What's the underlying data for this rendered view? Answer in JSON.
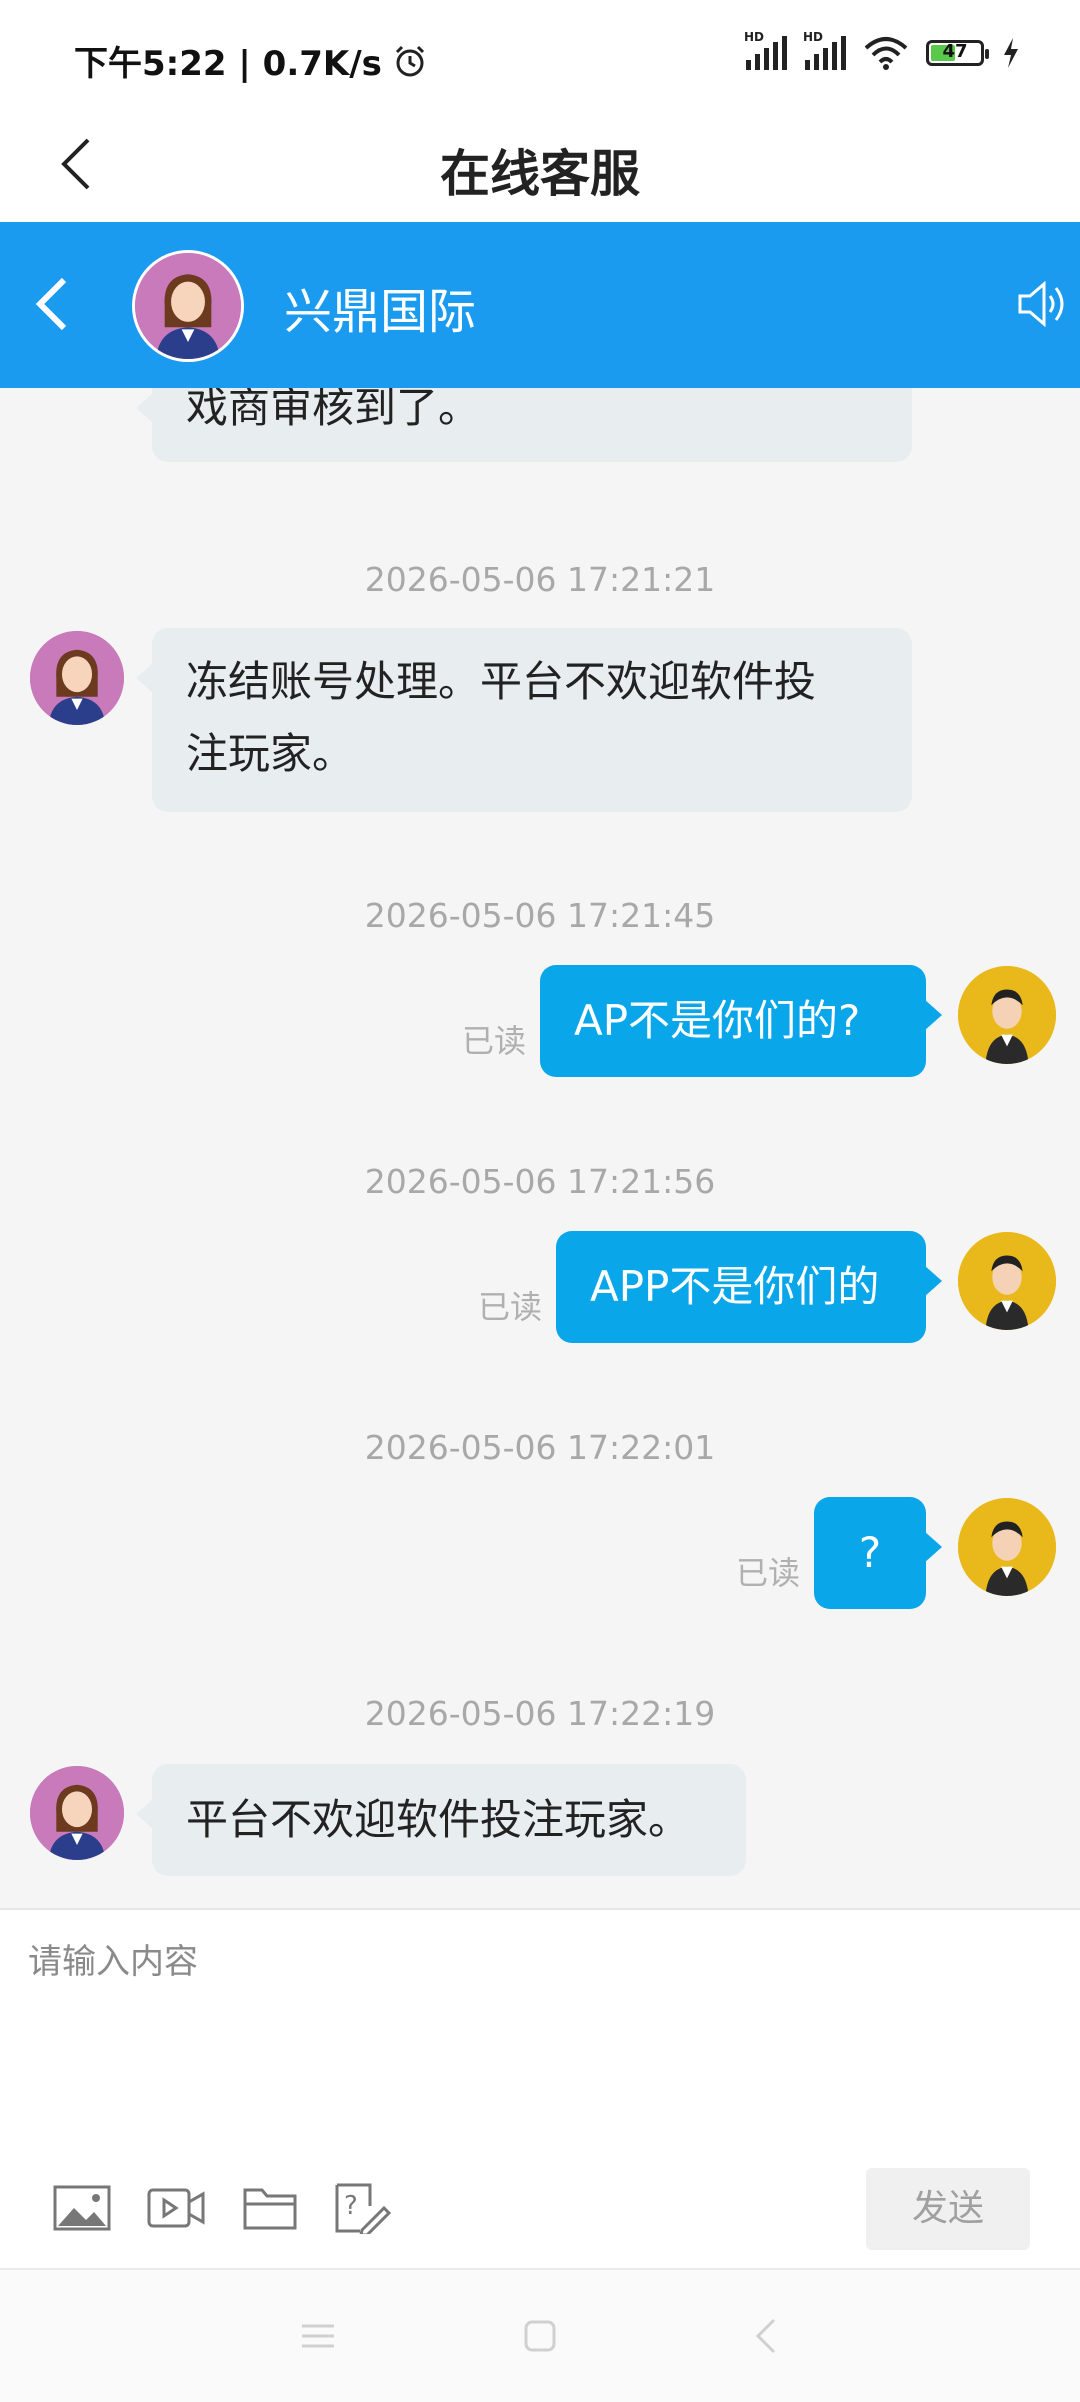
{
  "status_bar": {
    "time_and_speed": "下午5:22 | 0.7K/s",
    "signal1_label": "HD",
    "signal2_label": "HD",
    "battery_level": "47"
  },
  "title_bar": {
    "title": "在线客服"
  },
  "chat_header": {
    "name": "兴鼎国际"
  },
  "messages": {
    "m0": {
      "text": "戏商审核到了。"
    },
    "m1": {
      "time": "2026-05-06 17:21:21",
      "lines": [
        "冻结账号处理。平台不欢迎软件投",
        "注玩家。"
      ]
    },
    "m2": {
      "time": "2026-05-06 17:21:45",
      "text": "AP不是你们的?",
      "status": "已读"
    },
    "m3": {
      "time": "2026-05-06 17:21:56",
      "text": "APP不是你们的",
      "status": "已读"
    },
    "m4": {
      "time": "2026-05-06 17:22:01",
      "text": "?",
      "status": "已读"
    },
    "m5": {
      "time": "2026-05-06 17:22:19",
      "text": "平台不欢迎软件投注玩家。"
    }
  },
  "composer": {
    "placeholder": "请输入内容",
    "send_label": "发送",
    "tools": [
      "image-icon",
      "video-icon",
      "folder-icon",
      "question-edit-icon"
    ]
  },
  "colors": {
    "header_blue": "#1a9bf0",
    "outgoing_bubble": "#0aa6ea",
    "incoming_bubble": "#e8edef"
  }
}
